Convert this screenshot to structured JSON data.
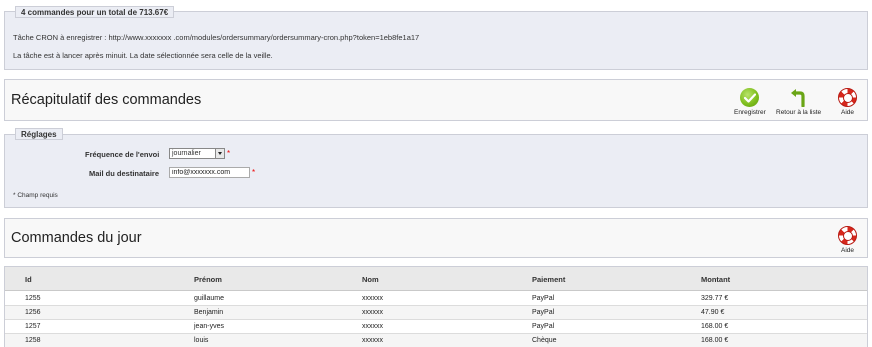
{
  "summary": {
    "legend": "4 commandes pour un total de 713.67€",
    "cron_text": "Tâche CRON à enregistrer : http://www.xxxxxxx .com/modules/ordersummary/ordersummary-cron.php?token=1eb8fe1a17",
    "info_text": "La tâche est à lancer après minuit. La date sélectionnée sera celle de la veille."
  },
  "toolbar1": {
    "title": "Récapitulatif des commandes",
    "save_label": "Enregistrer",
    "back_label": "Retour à la liste",
    "help_label": "Aide"
  },
  "settings": {
    "legend": "Réglages",
    "frequency_label": "Fréquence de l'envoi",
    "frequency_value": "journalier",
    "mail_label": "Mail du destinataire",
    "mail_value": "info@xxxxxxx.com",
    "required_mark": "*",
    "required_note": "* Champ requis"
  },
  "toolbar2": {
    "title": "Commandes du jour",
    "help_label": "Aide"
  },
  "table": {
    "columns": [
      "Id",
      "Prénom",
      "Nom",
      "Paiement",
      "Montant"
    ],
    "rows": [
      [
        "1255",
        "guillaume",
        "xxxxxx",
        "PayPal",
        "329.77 €"
      ],
      [
        "1256",
        "Benjamin",
        "xxxxxx",
        "PayPal",
        "47.90 €"
      ],
      [
        "1257",
        "jean-yves",
        "xxxxxx",
        "PayPal",
        "168.00 €"
      ],
      [
        "1258",
        "louis",
        "xxxxxx",
        "Chèque",
        "168.00 €"
      ]
    ]
  },
  "colors": {
    "fieldset_bg": "#ebedf4",
    "panel_bg": "#f8f8f8",
    "border": "#ccced7",
    "required": "#ee0000",
    "save_green": "#7fbf1e",
    "back_green": "#6aa516",
    "help_red": "#d8271c"
  },
  "icons": {
    "save": "checkmark-circle-icon",
    "back": "back-arrow-icon",
    "help": "lifebuoy-icon"
  }
}
